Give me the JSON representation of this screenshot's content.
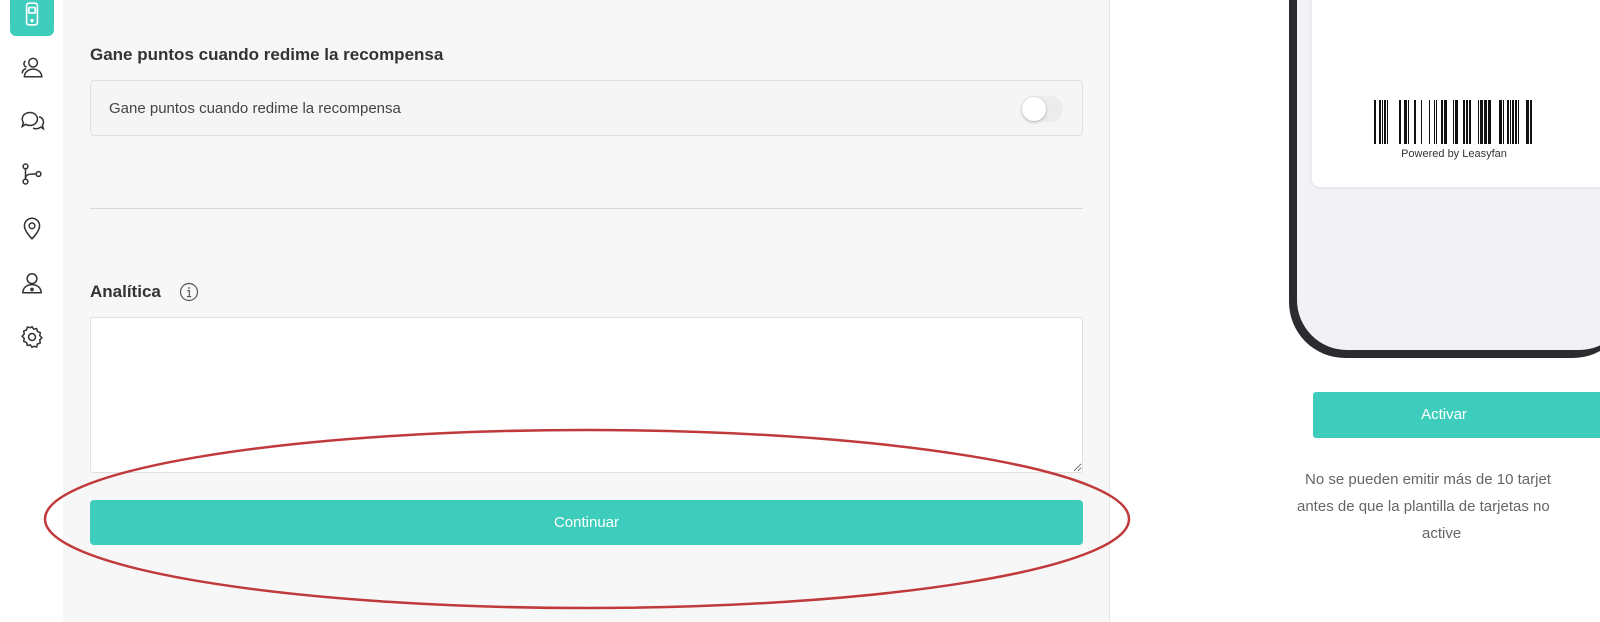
{
  "sidebar": {
    "items": [
      {
        "name": "phone-icon",
        "active": true
      },
      {
        "name": "users-icon",
        "active": false
      },
      {
        "name": "chat-icon",
        "active": false
      },
      {
        "name": "flow-icon",
        "active": false
      },
      {
        "name": "location-icon",
        "active": false
      },
      {
        "name": "user-icon",
        "active": false
      },
      {
        "name": "gear-icon",
        "active": false
      }
    ],
    "accent_color": "#3ecdbc"
  },
  "form": {
    "redeem_section_title": "Gane puntos cuando redime la recompensa",
    "redeem_toggle_label": "Gane puntos cuando redime la recompensa",
    "redeem_toggle_on": false,
    "analytics_label": "Analítica",
    "analytics_value": "",
    "continue_label": "Continuar"
  },
  "preview": {
    "powered_by": "Powered by Leasyfan",
    "activate_label": "Activar",
    "notice_lines": [
      "No se pueden emitir más de 10 tarjet",
      "antes de que la plantilla de tarjetas no",
      "active"
    ]
  },
  "annotation": {
    "shape": "ellipse",
    "color": "#c0393b",
    "target": "continue-button"
  }
}
